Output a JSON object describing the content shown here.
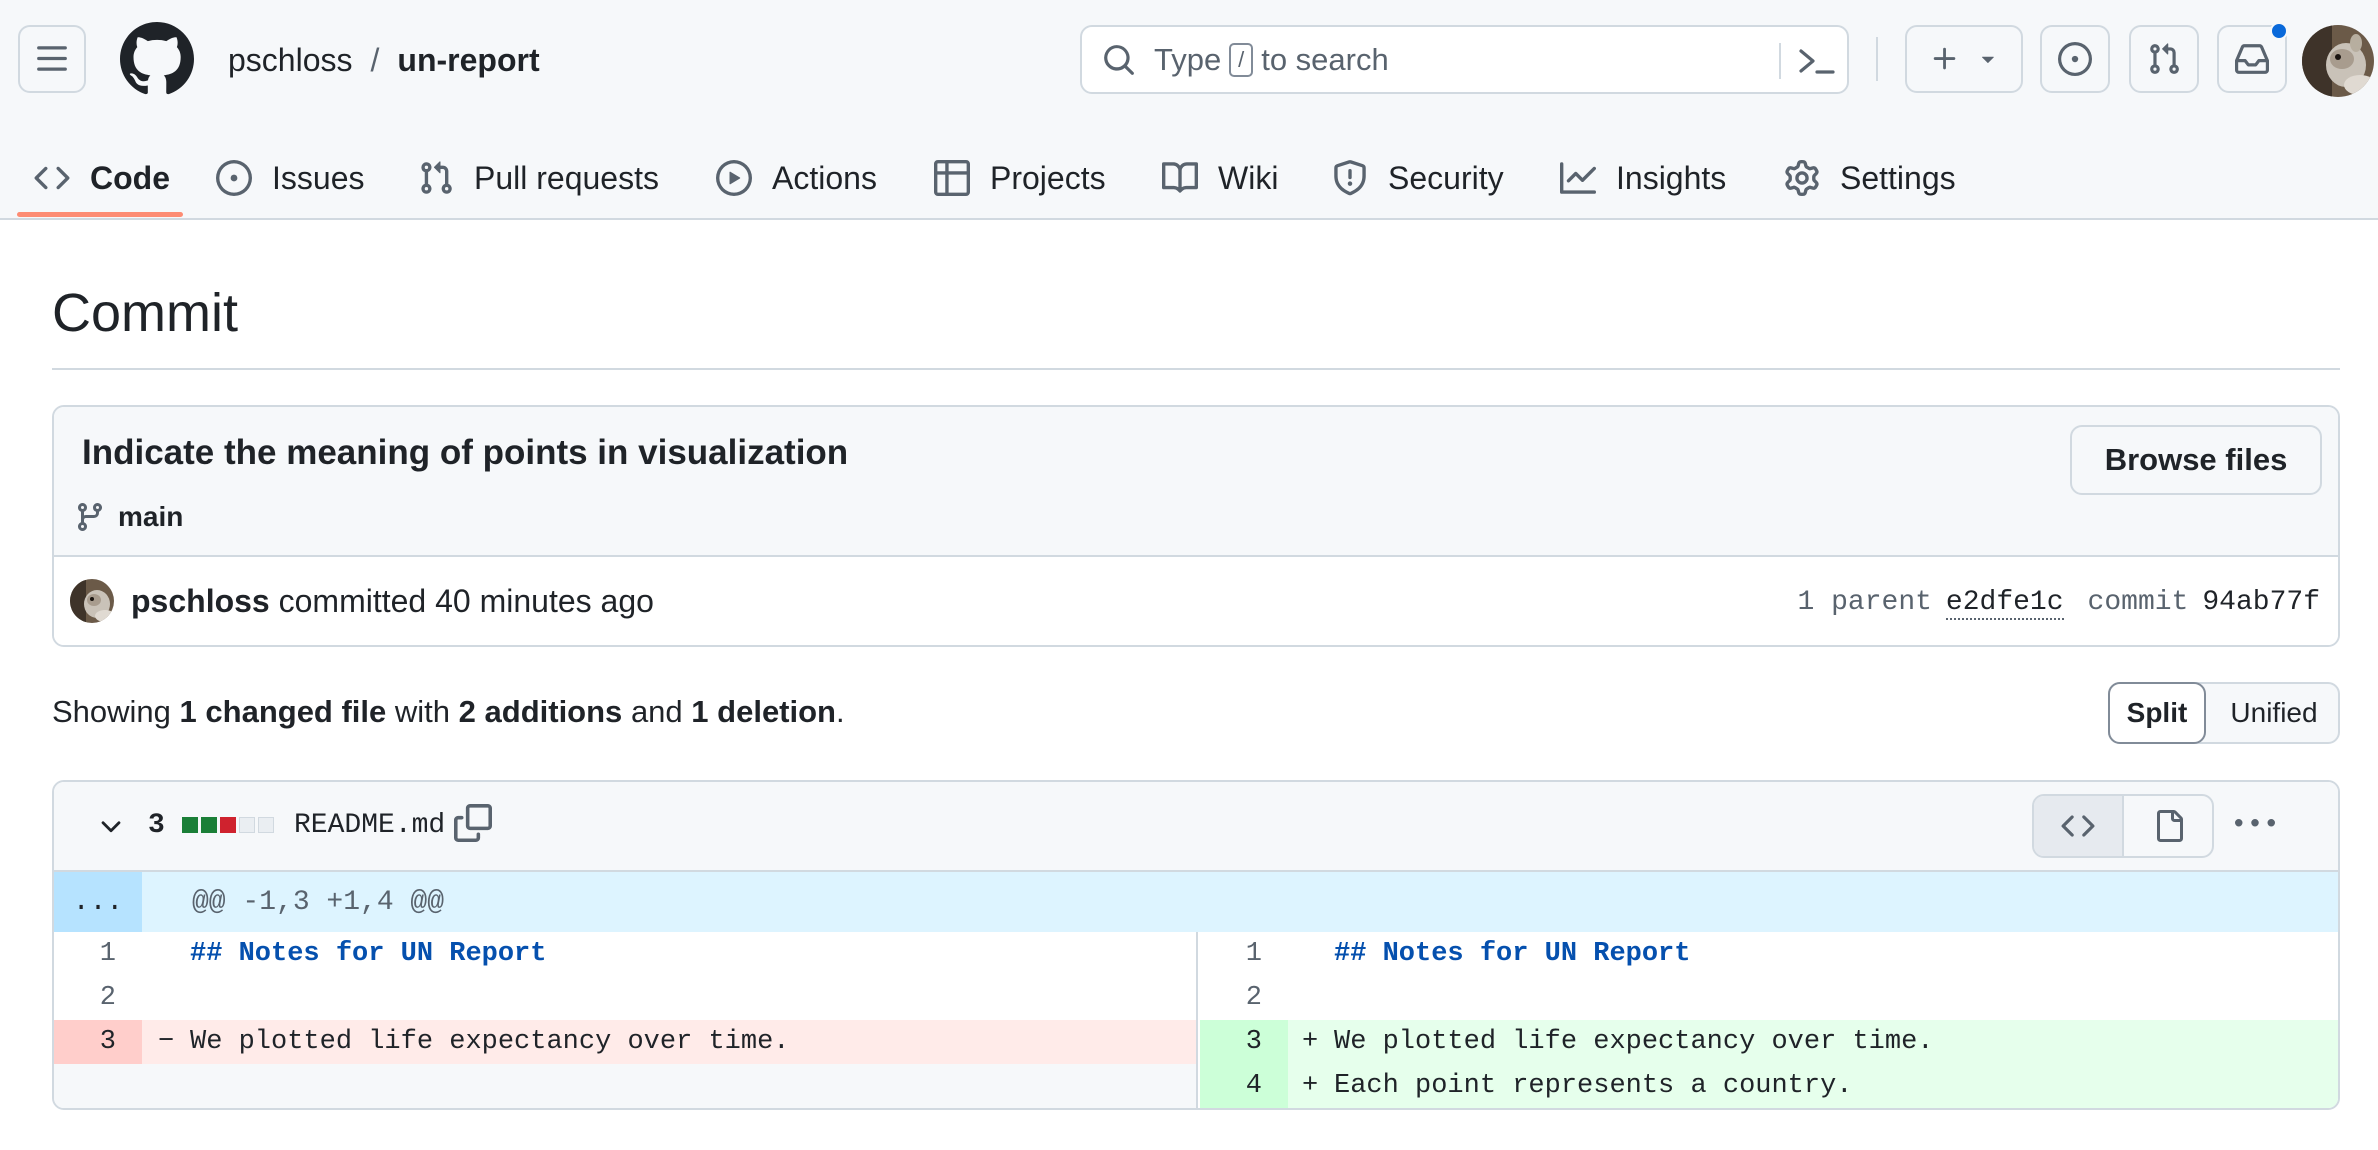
{
  "header": {
    "owner": "pschloss",
    "separator": "/",
    "repo": "un-report",
    "search": {
      "prefix": "Type",
      "key": "/",
      "suffix": "to search"
    }
  },
  "nav": {
    "items": [
      {
        "label": "Code",
        "icon": "code-icon",
        "active": true
      },
      {
        "label": "Issues",
        "icon": "issue-opened-icon"
      },
      {
        "label": "Pull requests",
        "icon": "git-pull-request-icon"
      },
      {
        "label": "Actions",
        "icon": "play-icon"
      },
      {
        "label": "Projects",
        "icon": "table-icon"
      },
      {
        "label": "Wiki",
        "icon": "book-icon"
      },
      {
        "label": "Security",
        "icon": "shield-icon"
      },
      {
        "label": "Insights",
        "icon": "graph-icon"
      },
      {
        "label": "Settings",
        "icon": "gear-icon"
      }
    ]
  },
  "page": {
    "title": "Commit"
  },
  "commit": {
    "message": "Indicate the meaning of points in visualization",
    "branch": "main",
    "browse_label": "Browse files",
    "author": "pschloss",
    "action": "committed 40 minutes ago",
    "parent_label": "1 parent",
    "parent_hash": "e2dfe1c",
    "commit_label": "commit",
    "commit_hash": "94ab77f"
  },
  "summary": {
    "prefix": "Showing",
    "changed": "1 changed file",
    "with": "with",
    "additions": "2 additions",
    "and": "and",
    "deletions": "1 deletion",
    "end": ".",
    "split_label": "Split",
    "unified_label": "Unified"
  },
  "file": {
    "changes": "3",
    "name": "README.md",
    "diffstat": [
      "add",
      "add",
      "del",
      "neutral",
      "neutral"
    ],
    "hunk_expander": "...",
    "hunk_header": "@@ -1,3 +1,4 @@",
    "left": [
      {
        "num": "1",
        "sign": "",
        "code": "## Notes for UN Report",
        "type": "ctx-heading"
      },
      {
        "num": "2",
        "sign": "",
        "code": "",
        "type": "ctx"
      },
      {
        "num": "3",
        "sign": "−",
        "code": "We plotted life expectancy over time.",
        "type": "del"
      },
      {
        "num": "",
        "sign": "",
        "code": "",
        "type": "empty"
      }
    ],
    "right": [
      {
        "num": "1",
        "sign": "",
        "code": "## Notes for UN Report",
        "type": "ctx-heading"
      },
      {
        "num": "2",
        "sign": "",
        "code": "",
        "type": "ctx"
      },
      {
        "num": "3",
        "sign": "+",
        "code": "We plotted life expectancy over time.",
        "type": "add"
      },
      {
        "num": "4",
        "sign": "+",
        "code": "Each point represents a country.",
        "type": "add"
      }
    ]
  },
  "colors": {
    "accent_underline": "#fd8c73",
    "addition": "#1a7f37",
    "deletion": "#cf222e",
    "notification": "#0969da"
  }
}
